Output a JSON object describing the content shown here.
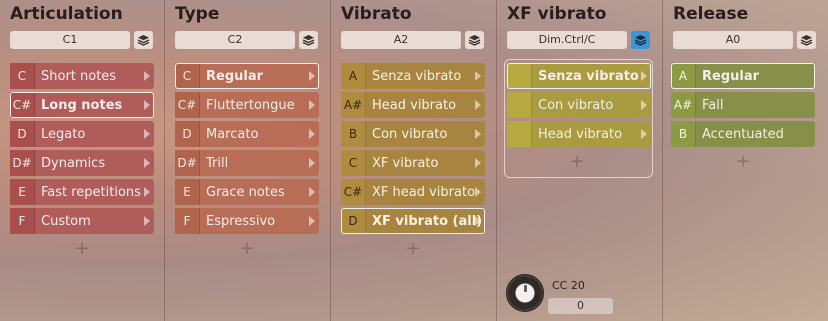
{
  "columns": {
    "articulation": {
      "title": "Articulation",
      "selector": "C1",
      "rows": [
        {
          "key": "C",
          "label": "Short notes"
        },
        {
          "key": "C#",
          "label": "Long notes"
        },
        {
          "key": "D",
          "label": "Legato"
        },
        {
          "key": "D#",
          "label": "Dynamics"
        },
        {
          "key": "E",
          "label": "Fast repetitions"
        },
        {
          "key": "F",
          "label": "Custom"
        }
      ],
      "add": "+"
    },
    "type": {
      "title": "Type",
      "selector": "C2",
      "rows": [
        {
          "key": "C",
          "label": "Regular"
        },
        {
          "key": "C#",
          "label": "Fluttertongue"
        },
        {
          "key": "D",
          "label": "Marcato"
        },
        {
          "key": "D#",
          "label": "Trill"
        },
        {
          "key": "E",
          "label": "Grace notes"
        },
        {
          "key": "F",
          "label": "Espressivo"
        }
      ],
      "add": "+"
    },
    "vibrato": {
      "title": "Vibrato",
      "selector": "A2",
      "rows": [
        {
          "key": "A",
          "label": "Senza vibrato"
        },
        {
          "key": "A#",
          "label": "Head vibrato"
        },
        {
          "key": "B",
          "label": "Con vibrato"
        },
        {
          "key": "C",
          "label": "XF vibrato"
        },
        {
          "key": "C#",
          "label": "XF head vibrato"
        },
        {
          "key": "D",
          "label": "XF vibrato (all)"
        }
      ],
      "add": "+"
    },
    "xf_vibrato": {
      "title": "XF vibrato",
      "selector": "Dim.Ctrl/C",
      "rows": [
        {
          "key": "",
          "label": "Senza vibrato"
        },
        {
          "key": "",
          "label": "Con vibrato"
        },
        {
          "key": "",
          "label": "Head vibrato"
        }
      ],
      "add": "+",
      "cc_label": "CC 20",
      "cc_value": "0"
    },
    "release": {
      "title": "Release",
      "selector": "A0",
      "rows": [
        {
          "key": "A",
          "label": "Regular"
        },
        {
          "key": "A#",
          "label": "Fall"
        },
        {
          "key": "B",
          "label": "Accentuated"
        }
      ],
      "add": "+"
    }
  },
  "colors": {
    "articulation": "#b05c5a",
    "type": "#b86d56",
    "vibrato": "#a7843f",
    "xf_vibrato": "#a99b3f",
    "release": "#869048",
    "active_layers": "#3a97d6"
  }
}
